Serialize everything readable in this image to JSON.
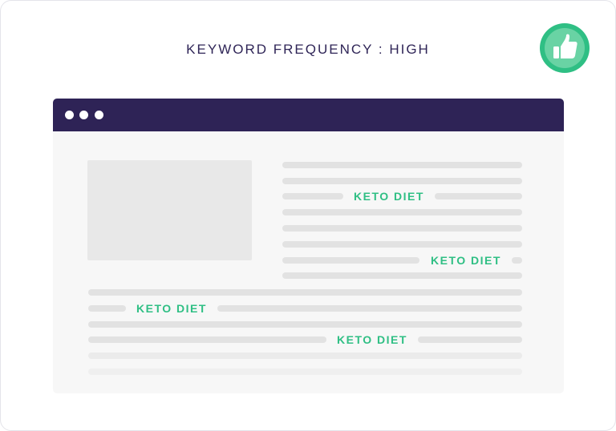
{
  "header": {
    "title": "KEYWORD FREQUENCY : HIGH",
    "rating_icon": "thumbs-up-icon",
    "rating_color": "#2fbf84"
  },
  "browser": {
    "titlebar_color": "#2e2356",
    "window_controls": [
      "dot-icon",
      "dot-icon",
      "dot-icon"
    ]
  },
  "content": {
    "keywords": [
      "KETO DIET",
      "KETO DIET",
      "KETO DIET",
      "KETO DIET"
    ],
    "keyword_color": "#2fbf84"
  }
}
